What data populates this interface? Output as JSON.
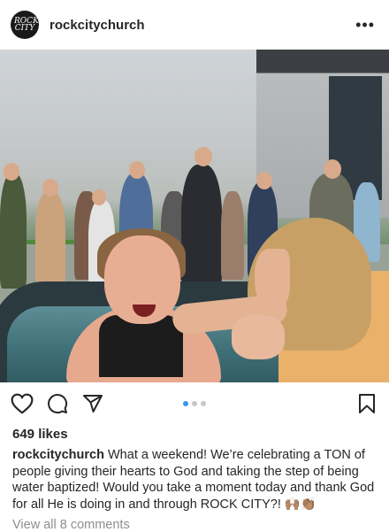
{
  "post": {
    "username": "rockcitychurch",
    "avatar_text": "ROCK CITY",
    "more_label": "•••",
    "likes": "649 likes",
    "caption_user": "rockcitychurch",
    "caption_text": "What a weekend! We’re celebrating a TON of people giving their hearts to God and taking the step of being water baptized! Would you take a moment today and thank God for all He is doing in and through ROCK CITY?! 🙌🏽👏🏽",
    "view_comments": "View all 8 comments",
    "carousel": {
      "count": 3,
      "active_index": 0
    }
  },
  "icons": {
    "like": "heart-icon",
    "comment": "comment-icon",
    "share": "send-icon",
    "save": "bookmark-icon"
  },
  "colors": {
    "accent": "#3897f0",
    "text": "#262626",
    "muted": "#8e8e8e"
  }
}
